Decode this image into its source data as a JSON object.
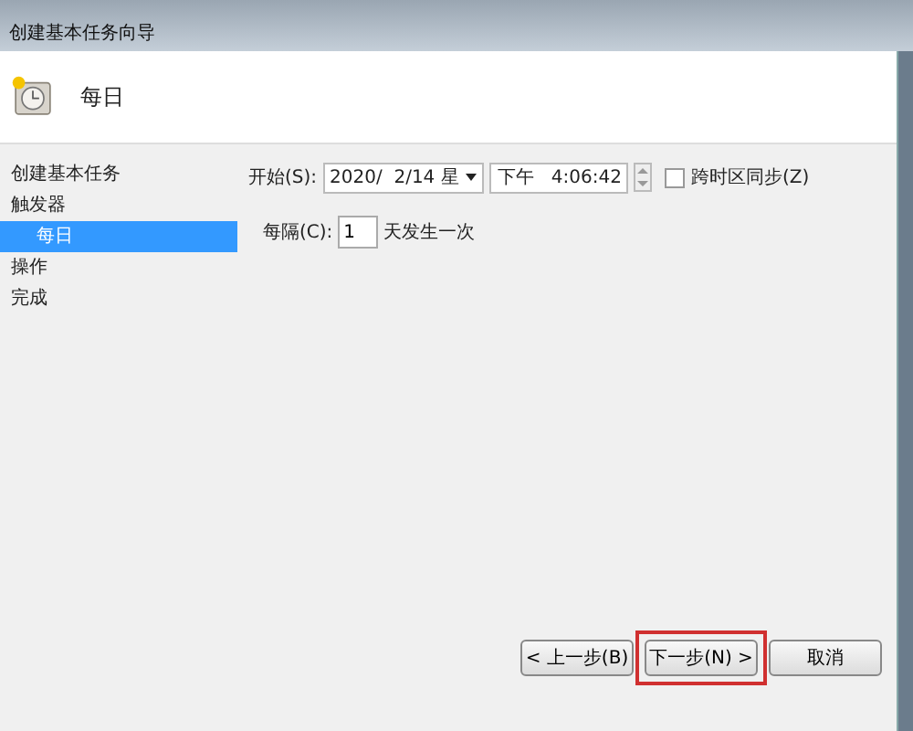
{
  "window": {
    "title": "创建基本任务向导"
  },
  "header": {
    "title": "每日"
  },
  "steps": [
    {
      "label": "创建基本任务",
      "selected": false
    },
    {
      "label": "触发器",
      "selected": false,
      "children": [
        {
          "label": "每日",
          "selected": true
        }
      ]
    },
    {
      "label": "操作",
      "selected": false
    },
    {
      "label": "完成",
      "selected": false
    }
  ],
  "start": {
    "label": "开始(S):",
    "date": "2020/  2/14 星",
    "time": "下午   4:06:42",
    "sync": {
      "label": "跨时区同步(Z)",
      "checked": false
    }
  },
  "recur": {
    "label": "每隔(C):",
    "value": "1",
    "suffix": "天发生一次"
  },
  "buttons": [
    {
      "label": "< 上一步(B)",
      "highlighted": false
    },
    {
      "label": "下一步(N) >",
      "highlighted": true
    },
    {
      "label": "取消",
      "highlighted": false
    }
  ]
}
